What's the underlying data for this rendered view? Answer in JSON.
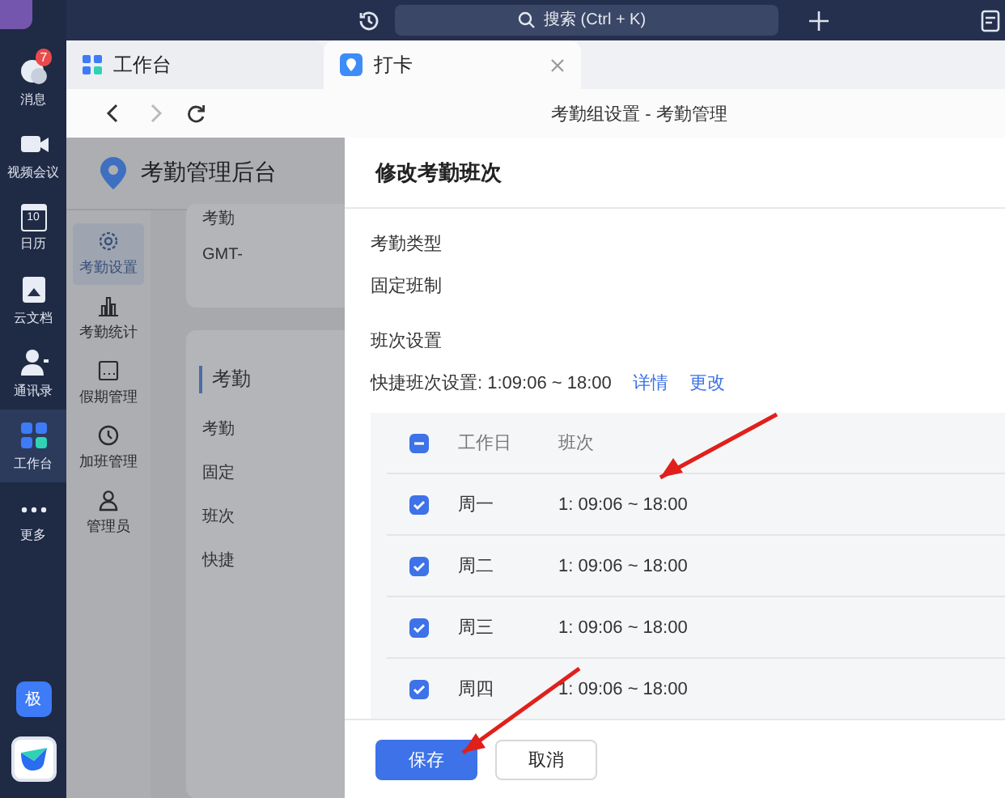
{
  "rail": {
    "items": [
      {
        "kind": "chat",
        "label": "消息",
        "badge": "7",
        "selected": false
      },
      {
        "kind": "video",
        "label": "视频会议",
        "selected": false
      },
      {
        "kind": "calendar",
        "label": "日历",
        "icon_text": "10",
        "selected": false
      },
      {
        "kind": "docs",
        "label": "云文档",
        "selected": false
      },
      {
        "kind": "contacts",
        "label": "通讯录",
        "selected": false
      },
      {
        "kind": "apps",
        "label": "工作台",
        "selected": true
      },
      {
        "kind": "more",
        "label": "更多",
        "selected": false
      }
    ],
    "level_badge": "极"
  },
  "topbar": {
    "search": {
      "placeholder": "搜索 (Ctrl + K)"
    }
  },
  "tabs": [
    {
      "label": "工作台",
      "kind": "apps",
      "selected": false,
      "closable": false
    },
    {
      "label": "打卡",
      "kind": "pin",
      "selected": true,
      "closable": true
    }
  ],
  "page_title": "考勤组设置 - 考勤管理",
  "background_app": {
    "title": "考勤管理后台",
    "nav": [
      {
        "kind": "gear",
        "label": "考勤设置",
        "selected": true
      },
      {
        "kind": "chart",
        "label": "考勤统计",
        "selected": false
      },
      {
        "kind": "calendar",
        "label": "假期管理",
        "selected": false
      },
      {
        "kind": "clock",
        "label": "加班管理",
        "selected": false
      },
      {
        "kind": "person",
        "label": "管理员",
        "selected": false
      }
    ],
    "card_1": [
      "考勤",
      "GMT-"
    ],
    "card_2": {
      "heading": "考勤",
      "lines": [
        "考勤",
        "固定",
        "班次",
        "快捷"
      ]
    }
  },
  "dialog": {
    "title": "修改考勤班次",
    "attendance_type": {
      "label": "考勤类型",
      "value": "固定班制"
    },
    "shift_settings": {
      "label": "班次设置",
      "quick": "快捷班次设置: 1:09:06 ~ 18:00",
      "links": [
        "详情",
        "更改"
      ]
    },
    "table": {
      "columns": [
        "工作日",
        "班次"
      ],
      "header_partial": true,
      "rows": [
        {
          "day": "周一",
          "shift": "1: 09:06 ~ 18:00",
          "checked": true
        },
        {
          "day": "周二",
          "shift": "1: 09:06 ~ 18:00",
          "checked": true
        },
        {
          "day": "周三",
          "shift": "1: 09:06 ~ 18:00",
          "checked": true
        },
        {
          "day": "周四",
          "shift": "1: 09:06 ~ 18:00",
          "checked": true
        }
      ]
    },
    "buttons": [
      {
        "label": "保存",
        "kind": "primary"
      },
      {
        "label": "取消",
        "kind": "default"
      }
    ]
  }
}
